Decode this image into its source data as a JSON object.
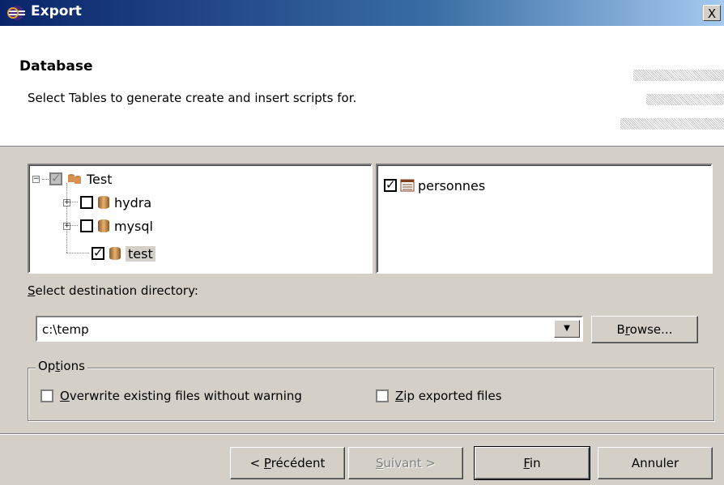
{
  "window": {
    "title": "Export",
    "close_label": "X"
  },
  "header": {
    "title": "Database",
    "description": "Select Tables to generate create and insert scripts for."
  },
  "tree": {
    "root": {
      "label": "Test",
      "state": "grayed"
    },
    "children": [
      {
        "label": "hydra",
        "checked": false,
        "expandable": true
      },
      {
        "label": "mysql",
        "checked": false,
        "expandable": true
      },
      {
        "label": "test",
        "checked": true,
        "expandable": false,
        "selected": true
      }
    ]
  },
  "tables": [
    {
      "label": "personnes",
      "checked": true
    }
  ],
  "destination": {
    "label_prefix": "S",
    "label_rest": "elect destination directory:",
    "value": "c:\\temp",
    "browse_prefix": "B",
    "browse_u": "r",
    "browse_rest": "owse..."
  },
  "options": {
    "legend_prefix": "Op",
    "legend_u": "t",
    "legend_rest": "ions",
    "overwrite_u": "O",
    "overwrite_rest": "verwrite existing files without warning",
    "overwrite_checked": false,
    "zip_u": "Z",
    "zip_rest": "ip exported files",
    "zip_checked": false
  },
  "buttons": {
    "back_prefix": "< ",
    "back_u": "P",
    "back_rest": "récédent",
    "next_u": "S",
    "next_rest": "uivant >",
    "finish_u": "F",
    "finish_rest": "in",
    "cancel": "Annuler"
  }
}
